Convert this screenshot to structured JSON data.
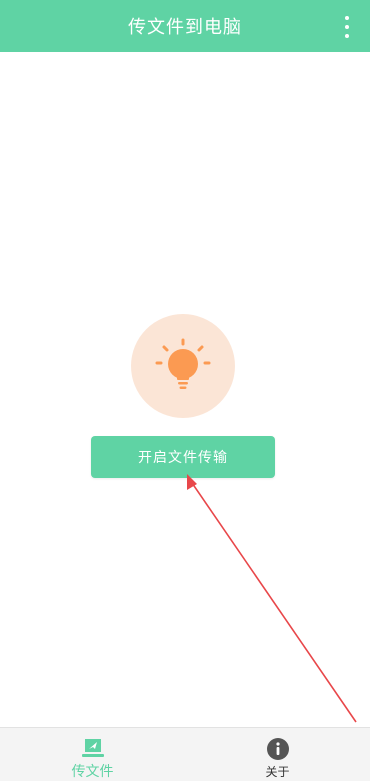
{
  "header": {
    "title": "传文件到电脑",
    "menu_icon": "more-vertical-icon"
  },
  "main": {
    "illustration_icon": "lightbulb-icon",
    "start_button_label": "开启文件传输"
  },
  "bottom_nav": {
    "items": [
      {
        "label": "传文件",
        "icon": "send-laptop-icon",
        "active": true
      },
      {
        "label": "关于",
        "icon": "info-icon",
        "active": false
      }
    ]
  },
  "colors": {
    "accent": "#5fd3a4",
    "bulb": "#fb9a52",
    "bulb_bg": "#fbe5d6",
    "annotation": "#e8474a"
  }
}
